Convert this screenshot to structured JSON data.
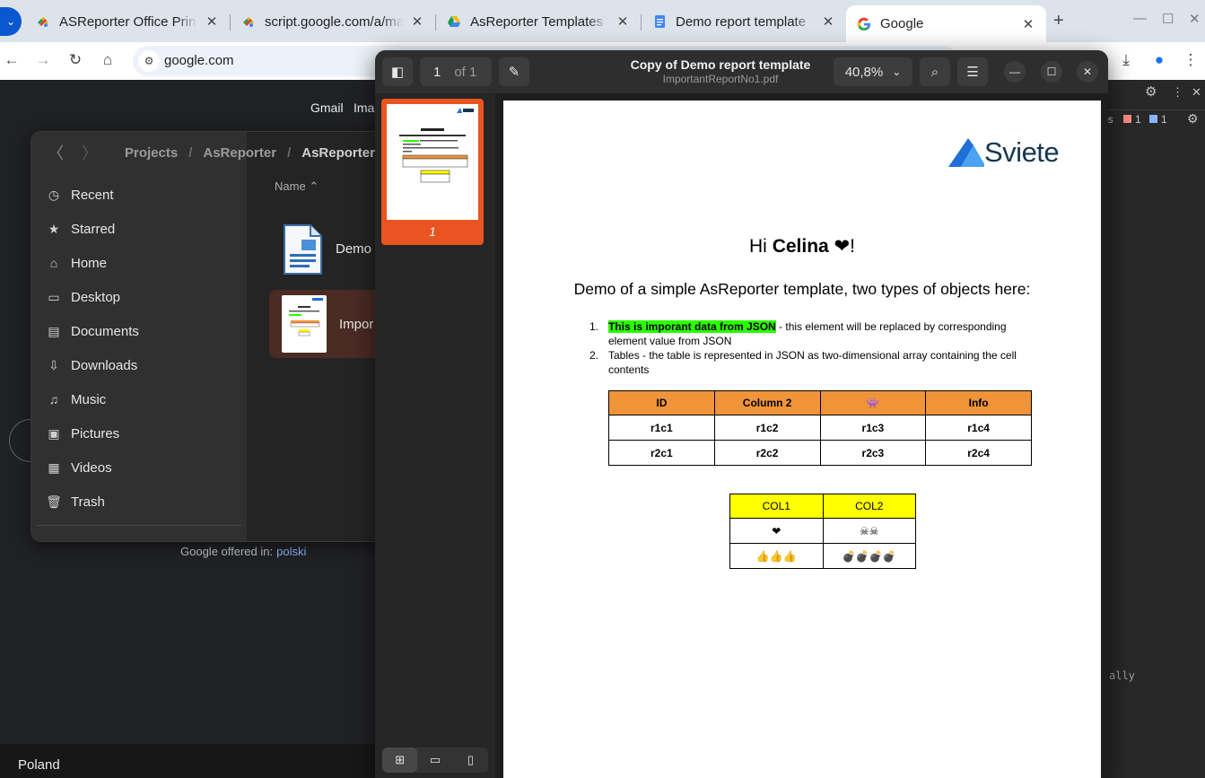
{
  "browser": {
    "tabs": [
      {
        "title": "ASReporter Office Prin",
        "favicon": "apps-script-icon"
      },
      {
        "title": "script.google.com/a/ma",
        "favicon": "apps-script-icon"
      },
      {
        "title": "AsReporter Templates",
        "favicon": "google-drive-icon"
      },
      {
        "title": "Demo report template",
        "favicon": "google-docs-icon"
      },
      {
        "title": "Google",
        "favicon": "google-icon",
        "active": true
      }
    ],
    "url": "google.com"
  },
  "google_page": {
    "links": [
      "Gmail",
      "Imag"
    ],
    "offered_in_label": "Google offered in:",
    "offered_in_lang": "polski",
    "footer_country": "Poland"
  },
  "devtools": {
    "badge_text": "es",
    "error_count": "1",
    "warning_count": "1",
    "snippet": "ally"
  },
  "files_window": {
    "path": [
      "Projects",
      "AsReporter",
      "AsReporter"
    ],
    "sidebar": [
      {
        "label": "Recent",
        "icon": "clock-icon"
      },
      {
        "label": "Starred",
        "icon": "star-icon"
      },
      {
        "label": "Home",
        "icon": "home-icon"
      },
      {
        "label": "Desktop",
        "icon": "desktop-icon"
      },
      {
        "label": "Documents",
        "icon": "document-icon"
      },
      {
        "label": "Downloads",
        "icon": "download-icon"
      },
      {
        "label": "Music",
        "icon": "music-icon"
      },
      {
        "label": "Pictures",
        "icon": "picture-icon"
      },
      {
        "label": "Videos",
        "icon": "video-icon"
      },
      {
        "label": "Trash",
        "icon": "trash-icon"
      }
    ],
    "column_header": "Name",
    "files": [
      {
        "name": "Demo",
        "selected": false
      },
      {
        "name": "Impor",
        "selected": true
      }
    ]
  },
  "pdf_viewer": {
    "page_current": "1",
    "page_total": "of 1",
    "title": "Copy of Demo report template",
    "filename": "ImportantReportNo1.pdf",
    "zoom": "40,8%",
    "thumb_page_number": "1",
    "document": {
      "logo": "Sviete",
      "greeting_prefix": "Hi ",
      "greeting_name": "Celina",
      "greeting_suffix": " ❤!",
      "intro": "Demo of a simple AsReporter template, two types of objects here:",
      "items": [
        {
          "num": "1.",
          "highlight": "This is imporant data from JSON",
          "text": " - this element will be replaced by corresponding element value from JSON"
        },
        {
          "num": "2.",
          "highlight": "",
          "text": "Tables - the table is represented in JSON as two-dimensional array containing the cell contents"
        }
      ],
      "table1": {
        "headers": [
          "ID",
          "Column 2",
          "👾",
          "Info"
        ],
        "rows": [
          [
            "r1c1",
            "r1c2",
            "r1c3",
            "r1c4"
          ],
          [
            "r2c1",
            "r2c2",
            "r2c3",
            "r2c4"
          ]
        ]
      },
      "table2": {
        "headers": [
          "COL1",
          "COL2"
        ],
        "rows": [
          [
            "❤",
            "☠☠"
          ],
          [
            "👍👍👍",
            "💣💣💣💣"
          ]
        ]
      }
    }
  },
  "colors": {
    "accent": "#e95420",
    "table_header_orange": "#f0943a",
    "table_header_yellow": "#ffff00",
    "highlight_green": "#2bff00"
  }
}
